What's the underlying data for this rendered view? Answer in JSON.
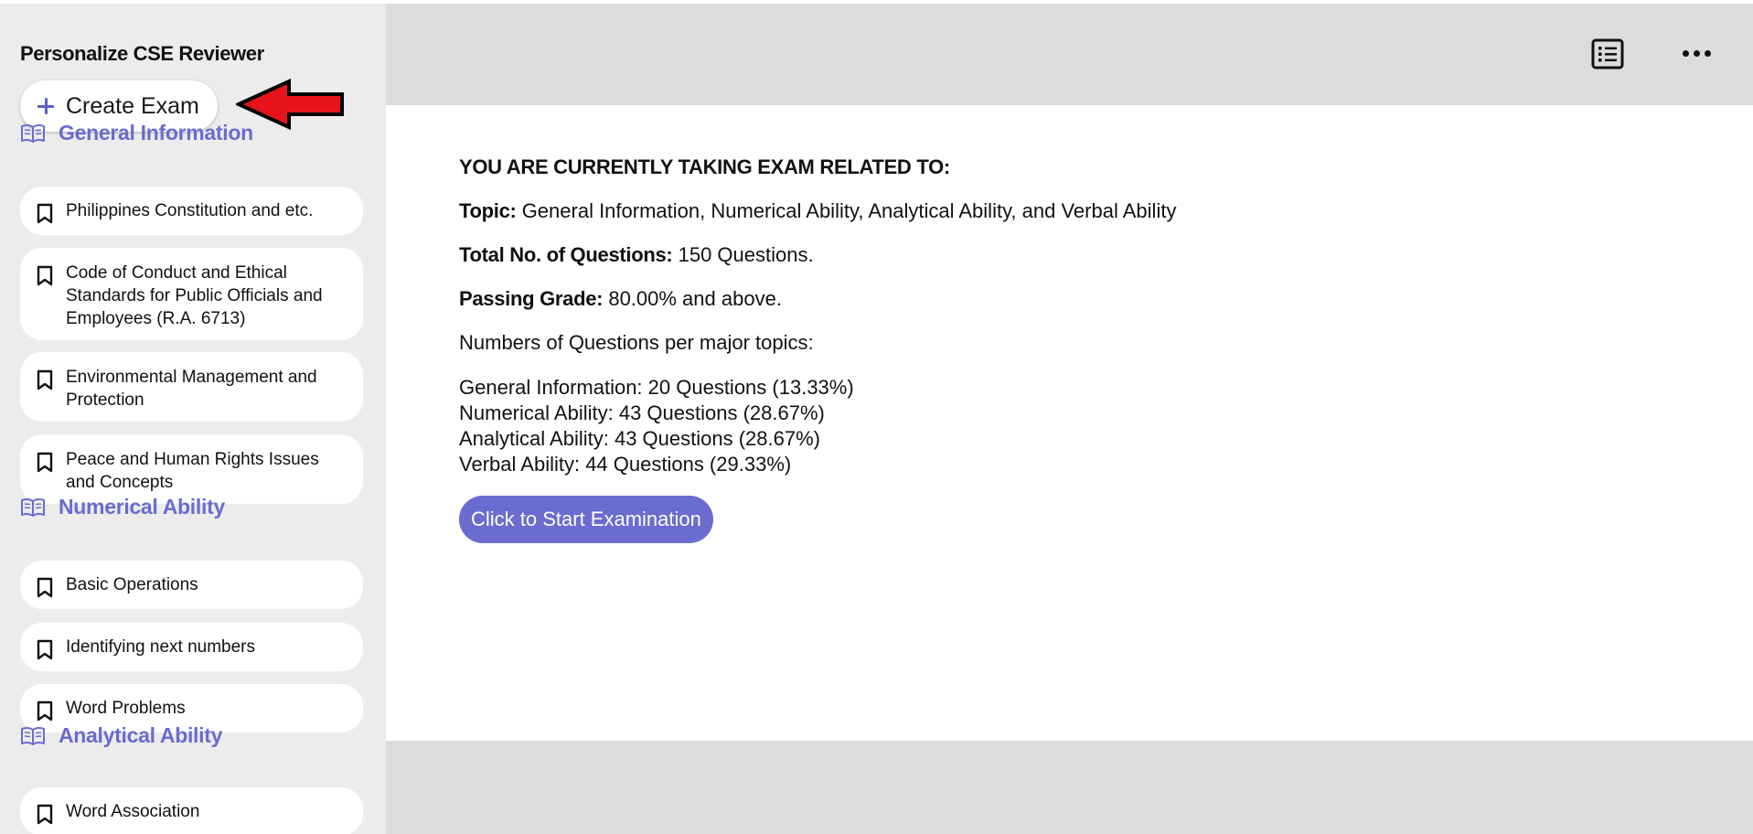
{
  "sidebar": {
    "title": "Personalize CSE Reviewer",
    "create_label": "Create Exam",
    "sections": [
      {
        "title": "General Information",
        "items": [
          "Philippines Constitution and etc.",
          "Code of Conduct and Ethical Standards for Public Officials and Employees (R.A. 6713)",
          "Environmental Management and Protection",
          "Peace and Human Rights Issues and Concepts"
        ]
      },
      {
        "title": "Numerical Ability",
        "items": [
          "Basic Operations",
          "Identifying next numbers",
          "Word Problems"
        ]
      },
      {
        "title": "Analytical Ability",
        "items": [
          "Word Association"
        ]
      }
    ]
  },
  "main": {
    "heading": "YOU ARE CURRENTLY TAKING EXAM RELATED TO:",
    "topic_label": "Topic:",
    "topic_value": "General Information, Numerical Ability, Analytical Ability, and Verbal Ability",
    "total_label": "Total No. of Questions:",
    "total_value": "150 Questions.",
    "passing_label": "Passing Grade:",
    "passing_value": "80.00% and above.",
    "per_topic_label": "Numbers of Questions per major topics:",
    "distribution": [
      "General Information: 20 Questions (13.33%)",
      "Numerical Ability: 43 Questions (28.67%)",
      "Analytical Ability: 43 Questions (28.67%)",
      "Verbal Ability: 44 Questions (29.33%)"
    ],
    "start_label": "Click to Start Examination"
  },
  "colors": {
    "accent": "#6a6ccf",
    "arrow": "#e8141c",
    "sidebar_bg": "#ececec",
    "chrome_bg": "#dcdcdc"
  },
  "icons": {
    "create": "plus-icon",
    "section": "open-book-icon",
    "item": "bookmark-icon",
    "toolbar_list": "list-view-icon",
    "toolbar_more": "more-horizontal-icon",
    "annotation": "red-arrow-icon"
  }
}
